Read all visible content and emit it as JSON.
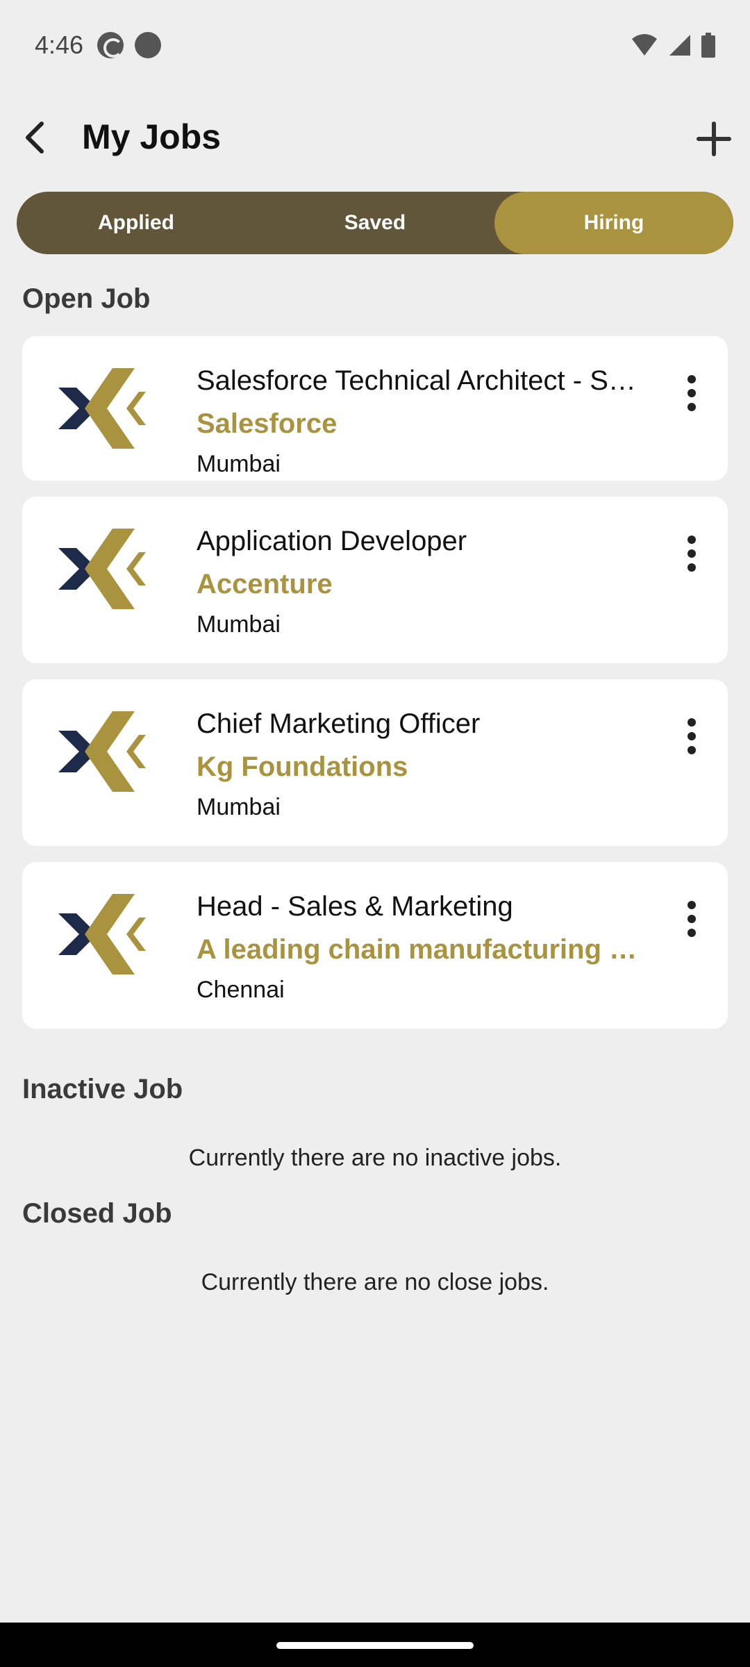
{
  "status_bar": {
    "time": "4:46"
  },
  "header": {
    "title": "My Jobs"
  },
  "tabs": [
    {
      "label": "Applied",
      "active": false
    },
    {
      "label": "Saved",
      "active": false
    },
    {
      "label": "Hiring",
      "active": true
    }
  ],
  "sections": {
    "open_title": "Open Job",
    "inactive_title": "Inactive Job",
    "inactive_empty": "Currently there are no inactive jobs.",
    "closed_title": "Closed Job",
    "closed_empty": "Currently there are no close jobs."
  },
  "open_jobs": [
    {
      "title": "Salesforce Technical Architect - Salesforce",
      "company": "Salesforce",
      "location": "Mumbai"
    },
    {
      "title": "Application Developer",
      "company": "Accenture",
      "location": "Mumbai"
    },
    {
      "title": "Chief Marketing Officer",
      "company": "Kg Foundations",
      "location": "Mumbai"
    },
    {
      "title": "Head - Sales & Marketing",
      "company": "A leading chain manufacturing company",
      "location": "Chennai"
    }
  ],
  "colors": {
    "accent_gold": "#a9933f",
    "tab_bar_dark": "#61563a",
    "logo_navy": "#1e2a4a",
    "background": "#eeeeee"
  },
  "icons": {
    "back": "arrow-back-icon",
    "add": "plus-icon",
    "more": "more-vert-icon",
    "logo": "company-logo-icon"
  }
}
